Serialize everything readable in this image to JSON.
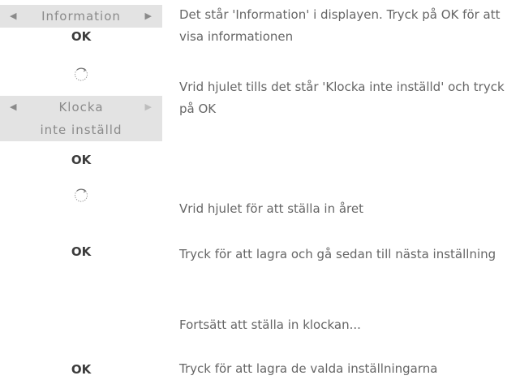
{
  "step1": {
    "display_label": "Information",
    "ok_label": "OK",
    "text": "Det står 'Information' i displayen. Tryck på OK för att visa informationen"
  },
  "step2": {
    "wheel_icon": "rotate-wheel-icon",
    "display_line1": "Klocka",
    "display_line2": "inte inställd",
    "ok_label": "OK",
    "text": "Vrid hjulet tills det står 'Klocka inte inställd' och tryck på OK"
  },
  "step3": {
    "wheel_icon": "rotate-wheel-icon",
    "text": "Vrid hjulet för att ställa in året"
  },
  "step4": {
    "ok_label": "OK",
    "text": "Tryck för att lagra och gå sedan till nästa inställning"
  },
  "step5": {
    "text": "Fortsätt att ställa in klockan..."
  },
  "step6": {
    "ok_label": "OK",
    "text": "Tryck för att lagra de valda inställningarna"
  },
  "icons": {
    "left_arrow": "◀",
    "right_arrow": "▶"
  }
}
